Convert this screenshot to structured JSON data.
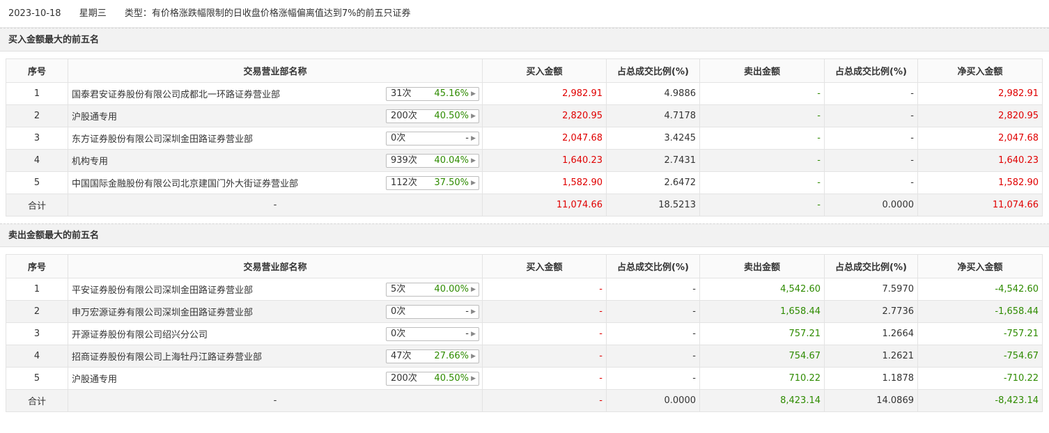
{
  "header": {
    "date": "2023-10-18",
    "weekday": "星期三",
    "type_label": "类型：有价格涨跌幅限制的日收盘价格涨幅偏离值达到7%的前五只证券"
  },
  "columns": [
    "序号",
    "交易营业部名称",
    "买入金额",
    "占总成交比例(%)",
    "卖出金额",
    "占总成交比例(%)",
    "净买入金额"
  ],
  "buy_section": {
    "title": "买入金额最大的前五名",
    "rows": [
      {
        "idx": "1",
        "name": "国泰君安证券股份有限公司成都北一环路证券营业部",
        "count": "31次",
        "pct": "45.16%",
        "buy": "2,982.91",
        "buy_ratio": "4.9886",
        "sell": "-",
        "sell_ratio": "-",
        "net": "2,982.91"
      },
      {
        "idx": "2",
        "name": "沪股通专用",
        "count": "200次",
        "pct": "40.50%",
        "buy": "2,820.95",
        "buy_ratio": "4.7178",
        "sell": "-",
        "sell_ratio": "-",
        "net": "2,820.95"
      },
      {
        "idx": "3",
        "name": "东方证券股份有限公司深圳金田路证券营业部",
        "count": "0次",
        "pct": "-",
        "buy": "2,047.68",
        "buy_ratio": "3.4245",
        "sell": "-",
        "sell_ratio": "-",
        "net": "2,047.68"
      },
      {
        "idx": "4",
        "name": "机构专用",
        "count": "939次",
        "pct": "40.04%",
        "buy": "1,640.23",
        "buy_ratio": "2.7431",
        "sell": "-",
        "sell_ratio": "-",
        "net": "1,640.23"
      },
      {
        "idx": "5",
        "name": "中国国际金融股份有限公司北京建国门外大街证券营业部",
        "count": "112次",
        "pct": "37.50%",
        "buy": "1,582.90",
        "buy_ratio": "2.6472",
        "sell": "-",
        "sell_ratio": "-",
        "net": "1,582.90"
      }
    ],
    "total": {
      "label": "合计",
      "name": "-",
      "buy": "11,074.66",
      "buy_ratio": "18.5213",
      "sell": "-",
      "sell_ratio": "0.0000",
      "net": "11,074.66"
    }
  },
  "sell_section": {
    "title": "卖出金额最大的前五名",
    "rows": [
      {
        "idx": "1",
        "name": "平安证券股份有限公司深圳金田路证券营业部",
        "count": "5次",
        "pct": "40.00%",
        "buy": "-",
        "buy_ratio": "-",
        "sell": "4,542.60",
        "sell_ratio": "7.5970",
        "net": "-4,542.60"
      },
      {
        "idx": "2",
        "name": "申万宏源证券有限公司深圳金田路证券营业部",
        "count": "0次",
        "pct": "-",
        "buy": "-",
        "buy_ratio": "-",
        "sell": "1,658.44",
        "sell_ratio": "2.7736",
        "net": "-1,658.44"
      },
      {
        "idx": "3",
        "name": "开源证券股份有限公司绍兴分公司",
        "count": "0次",
        "pct": "-",
        "buy": "-",
        "buy_ratio": "-",
        "sell": "757.21",
        "sell_ratio": "1.2664",
        "net": "-757.21"
      },
      {
        "idx": "4",
        "name": "招商证券股份有限公司上海牡丹江路证券营业部",
        "count": "47次",
        "pct": "27.66%",
        "buy": "-",
        "buy_ratio": "-",
        "sell": "754.67",
        "sell_ratio": "1.2621",
        "net": "-754.67"
      },
      {
        "idx": "5",
        "name": "沪股通专用",
        "count": "200次",
        "pct": "40.50%",
        "buy": "-",
        "buy_ratio": "-",
        "sell": "710.22",
        "sell_ratio": "1.1878",
        "net": "-710.22"
      }
    ],
    "total": {
      "label": "合计",
      "name": "-",
      "buy": "-",
      "buy_ratio": "0.0000",
      "sell": "8,423.14",
      "sell_ratio": "14.0869",
      "net": "-8,423.14"
    }
  },
  "colors": {
    "positive": "#e00000",
    "negative": "#2e8b00",
    "pct": "#2e8b00"
  },
  "icons": {
    "badge_arrow": "triangle-right-icon"
  }
}
